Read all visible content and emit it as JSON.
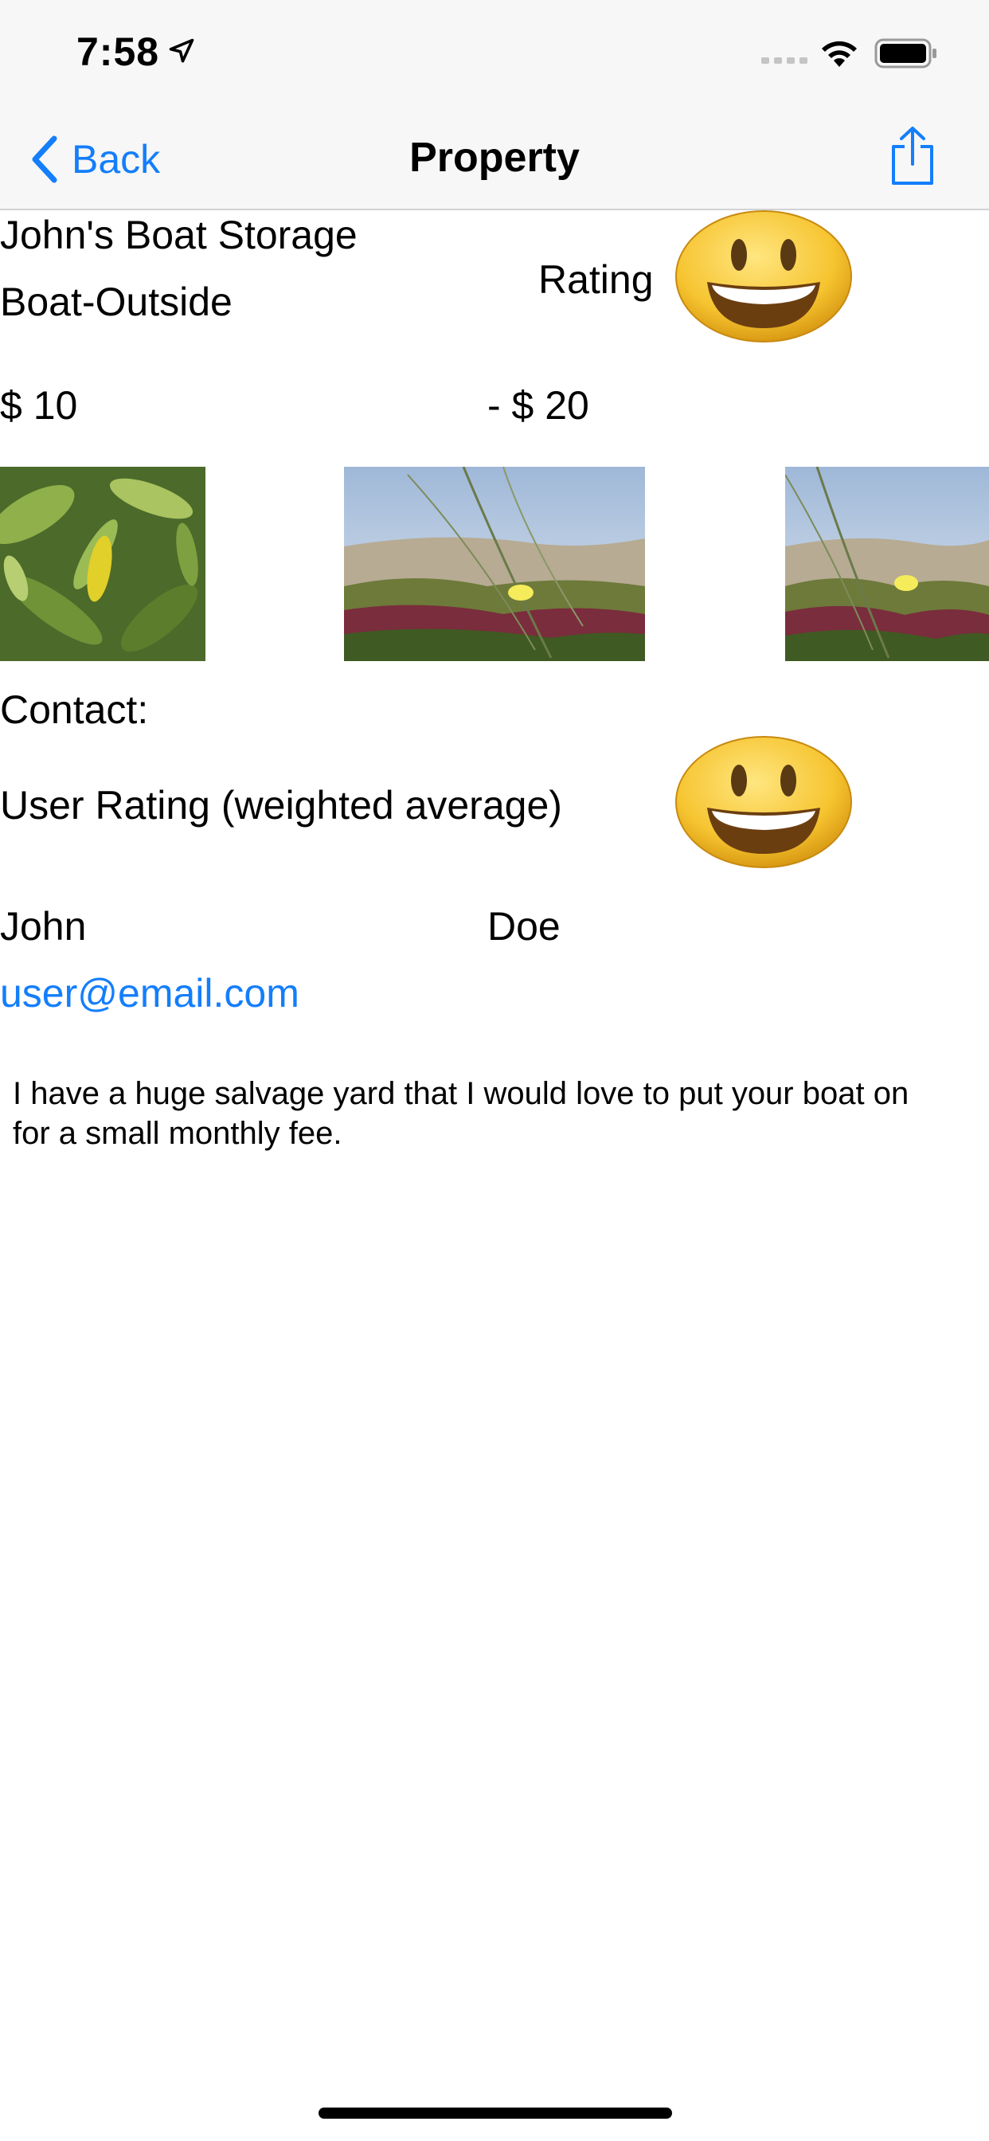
{
  "status_bar": {
    "time": "7:58"
  },
  "nav": {
    "back_label": "Back",
    "title": "Property"
  },
  "property": {
    "name": "John's Boat Storage",
    "type": "Boat-Outside",
    "rating_label": "Rating",
    "price_min": "$ 10",
    "price_max": "- $ 20"
  },
  "contact": {
    "label": "Contact:",
    "user_rating_label": "User Rating (weighted average)",
    "first_name": "John",
    "last_name": "Doe",
    "email": "user@email.com"
  },
  "description": "I have a huge salvage yard that I would love to put your boat on for a small monthly fee.",
  "colors": {
    "accent": "#147efb",
    "nav_background": "#f7f7f7"
  }
}
